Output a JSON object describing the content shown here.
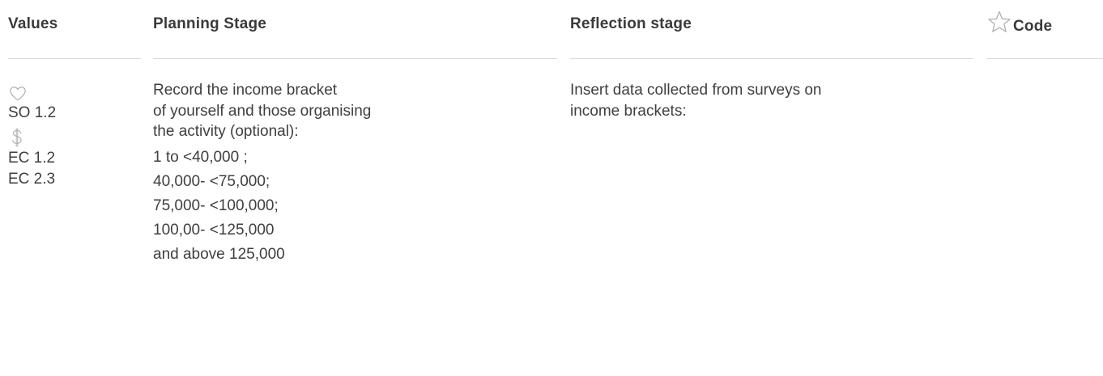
{
  "columns": {
    "values": {
      "header": "Values",
      "icons": [
        "heart-icon",
        "dollar-icon"
      ],
      "codes_group1": [
        "SO 1.2"
      ],
      "codes_group2": [
        "EC 1.2",
        "EC 2.3"
      ]
    },
    "planning": {
      "header": "Planning Stage",
      "intro": [
        "Record the income bracket",
        "of yourself and those organising",
        "the activity (optional):"
      ],
      "brackets": [
        "1 to <40,000 ;",
        "40,000- <75,000;",
        "75,000- <100,000;",
        "100,00- <125,000",
        "and above 125,000"
      ]
    },
    "reflection": {
      "header": "Reflection stage",
      "text": [
        "Insert data collected from surveys on",
        "income brackets:"
      ]
    },
    "code": {
      "header": "Code",
      "icon": "star-icon"
    }
  },
  "colors": {
    "text": "#3f3f3f",
    "icon": "#b0b0b0",
    "divider": "#d9d9d9"
  }
}
